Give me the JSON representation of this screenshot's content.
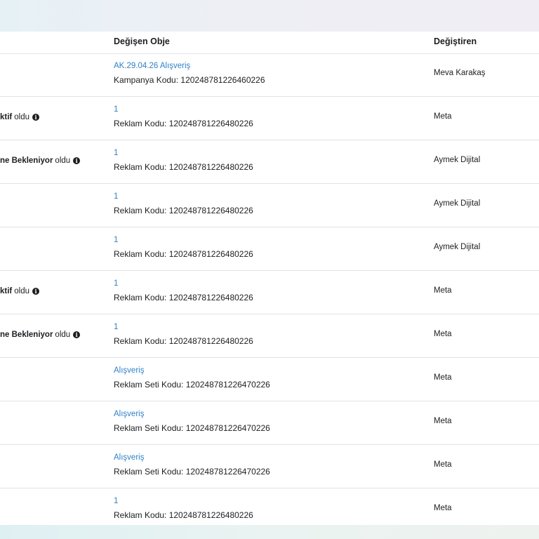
{
  "table": {
    "headers": {
      "changed_object": "Değişen Obje",
      "changed_by": "Değiştiren"
    },
    "rows": [
      {
        "status_bold": "",
        "status_suffix": "",
        "info_icon": false,
        "object_link": "AK.29.04.26 Alışveriş",
        "object_code": "Kampanya Kodu: 120248781226460226",
        "changed_by": "Meva Karakaş"
      },
      {
        "status_bold": "ktif",
        "status_suffix": "oldu",
        "info_icon": true,
        "object_link": "1",
        "object_code": "Reklam Kodu: 120248781226480226",
        "changed_by": "Meta"
      },
      {
        "status_bold": "ne Bekleniyor",
        "status_suffix": "oldu",
        "info_icon": true,
        "object_link": "1",
        "object_code": "Reklam Kodu: 120248781226480226",
        "changed_by": "Aymek Dijital"
      },
      {
        "status_bold": "",
        "status_suffix": "",
        "info_icon": false,
        "object_link": "1",
        "object_code": "Reklam Kodu: 120248781226480226",
        "changed_by": "Aymek Dijital"
      },
      {
        "status_bold": "",
        "status_suffix": "",
        "info_icon": false,
        "object_link": "1",
        "object_code": "Reklam Kodu: 120248781226480226",
        "changed_by": "Aymek Dijital"
      },
      {
        "status_bold": "ktif",
        "status_suffix": "oldu",
        "info_icon": true,
        "object_link": "1",
        "object_code": "Reklam Kodu: 120248781226480226",
        "changed_by": "Meta"
      },
      {
        "status_bold": "ne Bekleniyor",
        "status_suffix": "oldu",
        "info_icon": true,
        "object_link": "1",
        "object_code": "Reklam Kodu: 120248781226480226",
        "changed_by": "Meta"
      },
      {
        "status_bold": "",
        "status_suffix": "",
        "info_icon": false,
        "object_link": "Alışveriş",
        "object_code": "Reklam Seti Kodu: 120248781226470226",
        "changed_by": "Meta"
      },
      {
        "status_bold": "",
        "status_suffix": "",
        "info_icon": false,
        "object_link": "Alışveriş",
        "object_code": "Reklam Seti Kodu: 120248781226470226",
        "changed_by": "Meta"
      },
      {
        "status_bold": "",
        "status_suffix": "",
        "info_icon": false,
        "object_link": "Alışveriş",
        "object_code": "Reklam Seti Kodu: 120248781226470226",
        "changed_by": "Meta"
      },
      {
        "status_bold": "",
        "status_suffix": "",
        "info_icon": false,
        "object_link": "1",
        "object_code": "Reklam Kodu: 120248781226480226",
        "changed_by": "Meta"
      }
    ]
  },
  "icons": {
    "info": "info-icon"
  },
  "colors": {
    "link": "#2f81c6",
    "text": "#1c1e21",
    "divider": "#dfe2e6"
  }
}
